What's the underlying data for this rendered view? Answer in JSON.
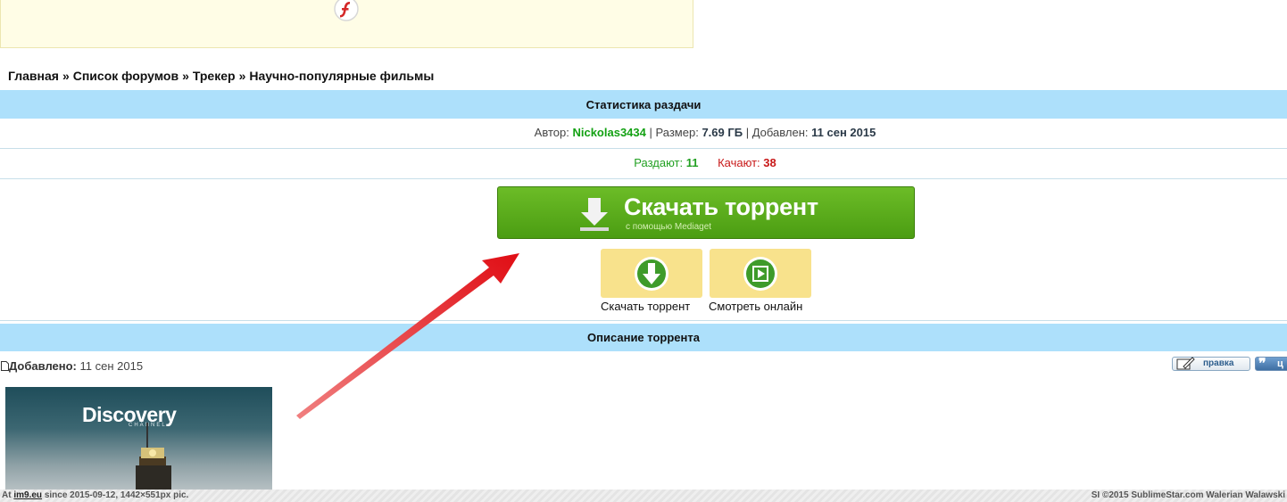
{
  "breadcrumb": {
    "items": [
      "Главная",
      "Список форумов",
      "Трекер",
      "Научно-популярные фильмы"
    ],
    "separator": "»"
  },
  "stats": {
    "header": "Статистика раздачи",
    "author_label": "Автор:",
    "author": "Nickolas3434",
    "size_label": "Размер:",
    "size": "7.69 ГБ",
    "added_label": "Добавлен:",
    "added": "11 сен 2015",
    "divider": "|",
    "seeders_label": "Раздают:",
    "seeders": "11",
    "leechers_label": "Качают:",
    "leechers": "38"
  },
  "download": {
    "main_label": "Скачать торрент",
    "main_sub": "с помощью Mediaget",
    "tile_download_label": "Скачать торрент",
    "tile_watch_label": "Смотреть онлайн"
  },
  "description": {
    "header": "Описание торрента",
    "added_label": "Добавлено:",
    "added_date": "11 сен 2015",
    "edit_label": "правка",
    "quote_label": "ц",
    "poster_brand": "Discovery",
    "poster_channel": "CHANNEL"
  },
  "footer": {
    "left_prefix": "At",
    "left_site": "im9.eu",
    "left_text": "since 2015-09-12, 1442×551px pic.",
    "right": "SI ©2015 SublimeStar.com Walerian Walawski"
  },
  "icons": [
    "flash-icon",
    "download-arrow-icon",
    "download-circle-icon",
    "play-film-icon",
    "document-icon",
    "pencil-icon",
    "red-arrow-annotation"
  ],
  "colors": {
    "header_bar": "#ade0fb",
    "download_button": "#58a81a",
    "tile": "#f8e28c",
    "seeders": "#22a022",
    "leechers": "#c81818",
    "author": "#13a113",
    "annotation_arrow": "#e8141a"
  }
}
